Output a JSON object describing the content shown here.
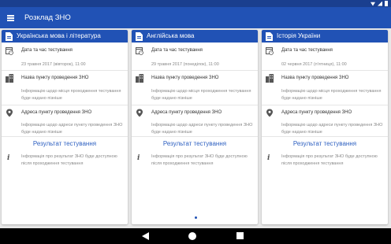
{
  "app": {
    "title": "Розклад ЗНО"
  },
  "colors": {
    "primary": "#2152b5",
    "status_bar": "#1a3f8f",
    "link": "#2c5fc0",
    "nav_bar": "#000000"
  },
  "icons": {
    "menu": "hamburger-menu-icon",
    "subject": "document-icon",
    "date": "calendar-clock-icon",
    "place": "building-icon",
    "address": "map-pin-icon",
    "info": "info-icon"
  },
  "cards": [
    {
      "subject": "Українська мова і література",
      "date_label": "Дата та час тестування",
      "date_value": "23 травня 2017 (вівторок), 11:00",
      "place_label": "Назва пункту проведення ЗНО",
      "place_value": "Інформацію щодо місця проходження тестування буде надано пізніше",
      "address_label": "Адреса пункту проведення ЗНО",
      "address_value": "Інформацію щодо адреси пункту проведення ЗНО буде надано пізніше",
      "result_label": "Результат тестування",
      "result_value": "Інформація про результат ЗНО буде доступною після проходження тестування"
    },
    {
      "subject": "Англійська мова",
      "date_label": "Дата та час тестування",
      "date_value": "29 травня 2017 (понеділок), 11:00",
      "place_label": "Назва пункту проведення ЗНО",
      "place_value": "Інформацію щодо місця проходження тестування буде надано пізніше",
      "address_label": "Адреса пункту проведення ЗНО",
      "address_value": "Інформацію щодо адреси пункту проведення ЗНО буде надано пізніше",
      "result_label": "Результат тестування",
      "result_value": "Інформація про результат ЗНО буде доступною після проходження тестування"
    },
    {
      "subject": "Історія України",
      "date_label": "Дата та час тестування",
      "date_value": "02 червня 2017 (п'ятниця), 11:00",
      "place_label": "Назва пункту проведення ЗНО",
      "place_value": "Інформацію щодо місця проходження тестування буде надано пізніше",
      "address_label": "Адреса пункту проведення ЗНО",
      "address_value": "Інформацію щодо адреси пункту проведення ЗНО буде надано пізніше",
      "result_label": "Результат тестування",
      "result_value": "Інформація про результат ЗНО буде доступною після проходження тестування"
    }
  ]
}
